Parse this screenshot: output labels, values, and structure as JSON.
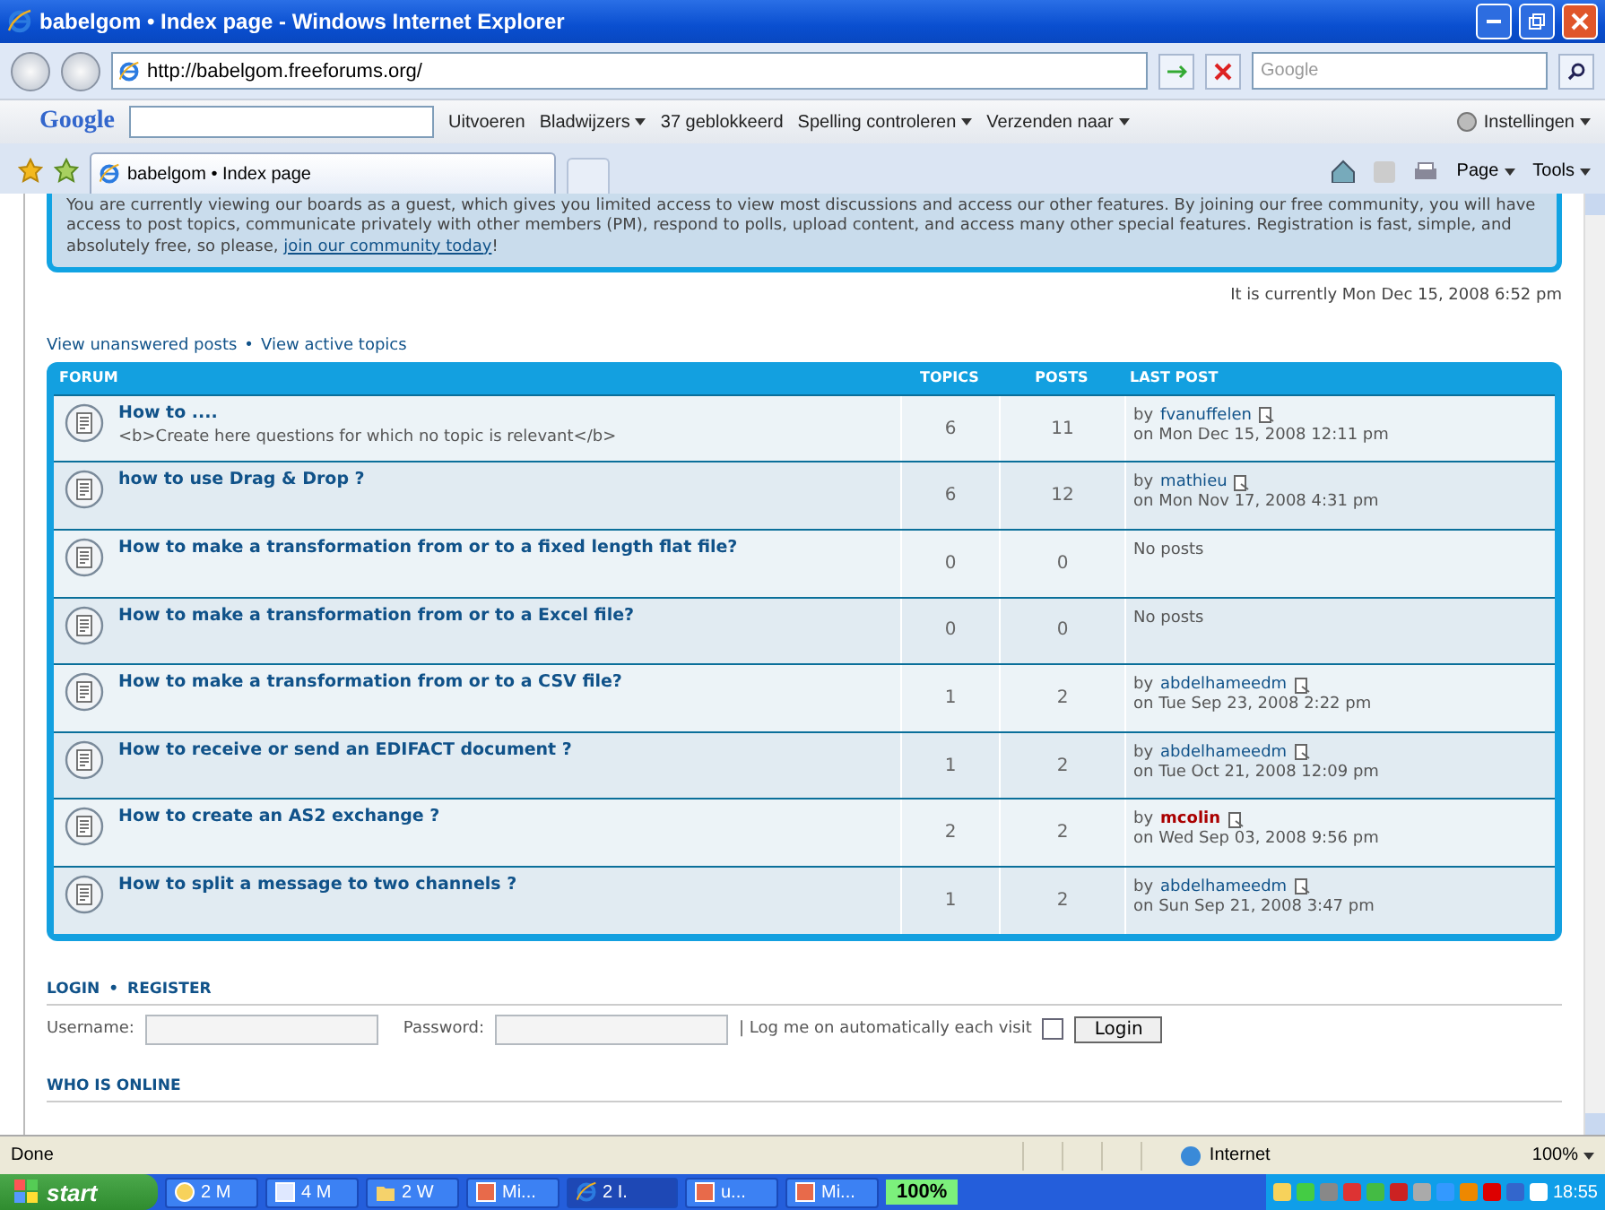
{
  "window": {
    "title": "babelgom • Index page - Windows Internet Explorer"
  },
  "address_bar": {
    "url": "http://babelgom.freeforums.org/",
    "search_placeholder": "Google"
  },
  "google_toolbar": {
    "brand": "Google",
    "items": [
      {
        "label": "Uitvoeren",
        "kind": "plain"
      },
      {
        "label": "Bladwijzers",
        "kind": "menu"
      },
      {
        "label": "37 geblokkeerd",
        "kind": "plain"
      },
      {
        "label": "Spelling controleren",
        "kind": "menu"
      },
      {
        "label": "Verzenden naar",
        "kind": "menu"
      }
    ],
    "settings": "Instellingen"
  },
  "tab": {
    "title": "babelgom • Index page"
  },
  "command_bar": [
    "Page",
    "Tools"
  ],
  "notice": {
    "text": "You are currently viewing our boards as a guest, which gives you limited access to view most discussions and access our other features. By joining our free community, you will have access to post topics, communicate privately with other members (PM), respond to polls, upload content, and access many other special features. Registration is fast, simple, and absolutely free, so please,",
    "link": "join our community today",
    "end": "!"
  },
  "current_time": "It is currently Mon Dec 15, 2008 6:52 pm",
  "quick_links": {
    "items": [
      "View unanswered posts",
      "View active topics"
    ],
    "separator": "•"
  },
  "forum_table": {
    "columns": [
      "FORUM",
      "TOPICS",
      "POSTS",
      "LAST POST"
    ],
    "rows": [
      {
        "title": "How to ....",
        "description": "<b>Create here questions for which no topic is relevant</b>",
        "topics": "6",
        "posts": "11",
        "last_post": {
          "by": "by",
          "author": "fvanuffelen",
          "color": "#105289",
          "date": "on Mon Dec 15, 2008 12:11 pm"
        }
      },
      {
        "title": "how to use Drag & Drop ?",
        "topics": "6",
        "posts": "12",
        "last_post": {
          "by": "by",
          "author": "mathieu",
          "color": "#105289",
          "date": "on Mon Nov 17, 2008 4:31 pm"
        }
      },
      {
        "title": "How to make a transformation from or to a fixed length flat file?",
        "topics": "0",
        "posts": "0",
        "no_posts": "No posts"
      },
      {
        "title": "How to make a transformation from or to a Excel file?",
        "topics": "0",
        "posts": "0",
        "no_posts": "No posts"
      },
      {
        "title": "How to make a transformation from or to a CSV file?",
        "topics": "1",
        "posts": "2",
        "last_post": {
          "by": "by",
          "author": "abdelhameedm",
          "color": "#105289",
          "date": "on Tue Sep 23, 2008 2:22 pm"
        }
      },
      {
        "title": "How to receive or send an EDIFACT document ?",
        "topics": "1",
        "posts": "2",
        "last_post": {
          "by": "by",
          "author": "abdelhameedm",
          "color": "#105289",
          "date": "on Tue Oct 21, 2008 12:09 pm"
        }
      },
      {
        "title": "How to create an AS2 exchange ?",
        "topics": "2",
        "posts": "2",
        "last_post": {
          "by": "by",
          "author": "mcolin",
          "color": "#aa0000",
          "date": "on Wed Sep 03, 2008 9:56 pm"
        }
      },
      {
        "title": "How to split a message to two channels ?",
        "topics": "1",
        "posts": "2",
        "last_post": {
          "by": "by",
          "author": "abdelhameedm",
          "color": "#105289",
          "date": "on Sun Sep 21, 2008 3:47 pm"
        }
      }
    ]
  },
  "login": {
    "links": [
      "LOGIN",
      "REGISTER"
    ],
    "separator": "•",
    "username_label": "Username:",
    "password_label": "Password:",
    "autologin_label": "| Log me on automatically each visit",
    "autologin_checked": false,
    "button": "Login"
  },
  "who_is_online": "WHO IS ONLINE",
  "status_bar": {
    "status": "Done",
    "zone": "Internet",
    "zoom": "100%"
  },
  "taskbar": {
    "start": "start",
    "tasks": [
      {
        "label": "2 M",
        "kind": "clock",
        "selected": false
      },
      {
        "label": "4 M",
        "kind": "word",
        "selected": false
      },
      {
        "label": "2 W",
        "kind": "folder",
        "selected": false
      },
      {
        "label": "Mi...",
        "kind": "app",
        "selected": false
      },
      {
        "label": "2 I.",
        "kind": "ie",
        "selected": true
      },
      {
        "label": "u...",
        "kind": "app",
        "selected": false
      },
      {
        "label": "Mi...",
        "kind": "app",
        "selected": false
      }
    ],
    "battery": "100%",
    "clock": "18:55"
  }
}
